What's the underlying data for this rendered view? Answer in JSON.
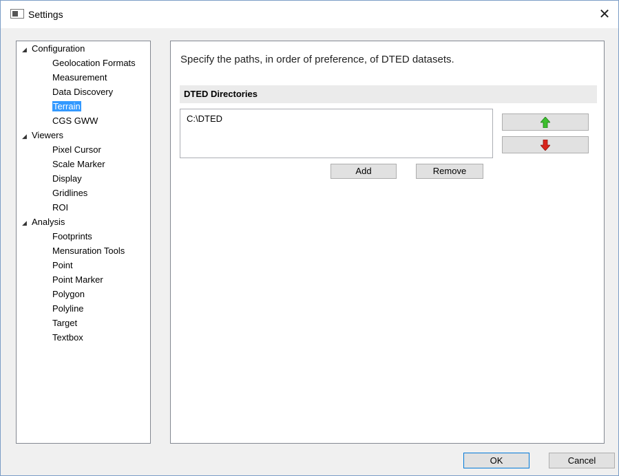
{
  "window": {
    "title": "Settings",
    "close_glyph": "✕"
  },
  "tree": {
    "items": [
      {
        "label": "Configuration",
        "level": 0,
        "expanded": true
      },
      {
        "label": "Geolocation Formats",
        "level": 1
      },
      {
        "label": "Measurement",
        "level": 1
      },
      {
        "label": "Data Discovery",
        "level": 1
      },
      {
        "label": "Terrain",
        "level": 1,
        "selected": true
      },
      {
        "label": "CGS GWW",
        "level": 1
      },
      {
        "label": "Viewers",
        "level": 0,
        "expanded": true
      },
      {
        "label": "Pixel Cursor",
        "level": 1
      },
      {
        "label": "Scale Marker",
        "level": 1
      },
      {
        "label": "Display",
        "level": 1
      },
      {
        "label": "Gridlines",
        "level": 1
      },
      {
        "label": "ROI",
        "level": 1
      },
      {
        "label": "Analysis",
        "level": 0,
        "expanded": true
      },
      {
        "label": "Footprints",
        "level": 1
      },
      {
        "label": "Mensuration Tools",
        "level": 1
      },
      {
        "label": "Point",
        "level": 1
      },
      {
        "label": "Point Marker",
        "level": 1
      },
      {
        "label": "Polygon",
        "level": 1
      },
      {
        "label": "Polyline",
        "level": 1
      },
      {
        "label": "Target",
        "level": 1
      },
      {
        "label": "Textbox",
        "level": 1
      }
    ],
    "expander_glyph": "◢",
    "selection_color": "#3399ff"
  },
  "terrain": {
    "description": "Specify the paths, in order of preference, of DTED datasets.",
    "section_title": "DTED Directories",
    "directories": [
      "C:\\DTED"
    ],
    "add_label": "Add",
    "remove_label": "Remove",
    "move_up_icon": "green-up-arrow-icon",
    "move_down_icon": "red-down-arrow-icon",
    "up_color": "#3cbf2e",
    "down_color": "#d9241c"
  },
  "footer": {
    "ok_label": "OK",
    "cancel_label": "Cancel"
  }
}
